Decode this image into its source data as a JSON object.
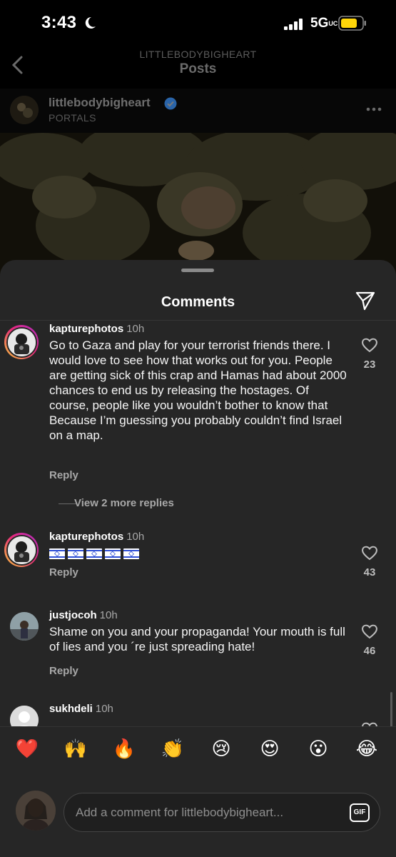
{
  "status_bar": {
    "time": "3:43",
    "network": "5G",
    "network_suffix": "UC"
  },
  "header": {
    "subtitle": "LITTLEBODYBIGHEART",
    "title": "Posts"
  },
  "author": {
    "username": "littlebodybigheart",
    "subtitle": "PORTALS"
  },
  "sheet": {
    "title": "Comments"
  },
  "comments": [
    {
      "username": "kapturephotos",
      "time": "10h",
      "text": "Go to Gaza and play for your terrorist friends there. I would love to see how that works out for you.  People are getting sick of this crap and Hamas had about 2000 chances to end us by releasing the hostages.  Of course, people like you wouldn’t bother to know that Because I’m guessing you probably couldn’t find Israel on a map.",
      "reply_label": "Reply",
      "likes": "23",
      "view_replies": "View 2 more replies"
    },
    {
      "username": "kapturephotos",
      "time": "10h",
      "flags": 5,
      "reply_label": "Reply",
      "likes": "43"
    },
    {
      "username": "justjocoh",
      "time": "10h",
      "text": "Shame on you and your propaganda! Your mouth is full of lies and you ´re just spreading hate!",
      "reply_label": "Reply",
      "likes": "46"
    },
    {
      "username": "sukhdeli",
      "time": "10h"
    }
  ],
  "emoji_bar": [
    "❤️",
    "🙌",
    "🔥",
    "👏",
    "😢",
    "😍",
    "😮",
    "😂"
  ],
  "composer": {
    "placeholder": "Add a comment for littlebodybigheart...",
    "gif_label": "GIF"
  },
  "colors": {
    "sheet": "#262626",
    "verified": "#3897f0",
    "battery": "#ffd60a"
  }
}
